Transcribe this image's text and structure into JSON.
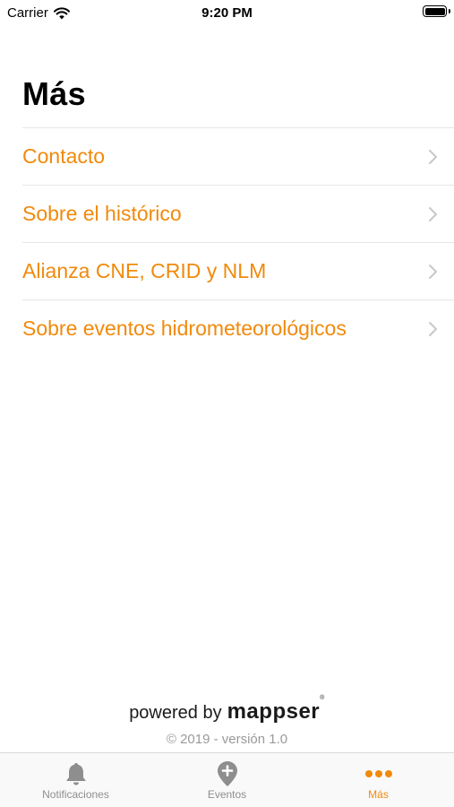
{
  "status_bar": {
    "carrier": "Carrier",
    "time": "9:20 PM"
  },
  "page": {
    "title": "Más"
  },
  "menu": {
    "items": [
      {
        "label": "Contacto"
      },
      {
        "label": "Sobre el histórico"
      },
      {
        "label": "Alianza CNE, CRID y NLM"
      },
      {
        "label": "Sobre eventos hidrometeorológicos"
      }
    ]
  },
  "footer": {
    "powered_by": "powered by",
    "brand": "mappser",
    "brand_mark": "®",
    "copyright": "© 2019 - versión 1.0"
  },
  "tabs": [
    {
      "label": "Notificaciones",
      "icon": "bell-icon",
      "active": false
    },
    {
      "label": "Eventos",
      "icon": "map-pin-plus-icon",
      "active": false
    },
    {
      "label": "Más",
      "icon": "more-dots-icon",
      "active": true
    }
  ],
  "colors": {
    "accent": "#F08A0C",
    "inactive": "#8E8E8E"
  }
}
